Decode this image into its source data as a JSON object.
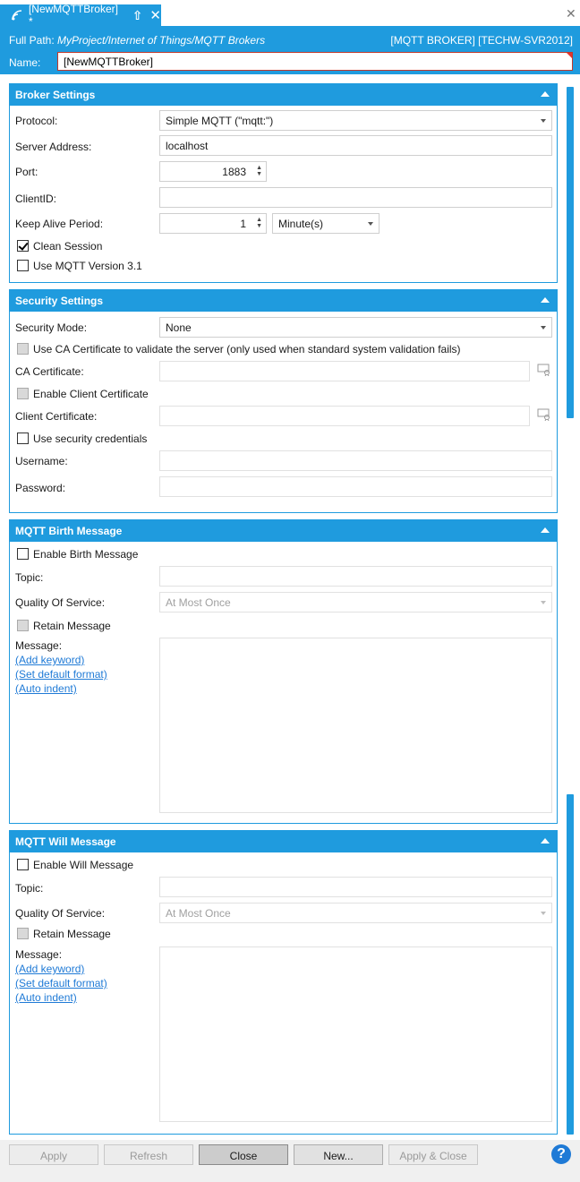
{
  "tab": {
    "title": "[NewMQTTBroker] *"
  },
  "header": {
    "full_path_label": "Full Path:",
    "full_path_value": "MyProject/Internet of Things/MQTT Brokers",
    "badge": "[MQTT BROKER] [TECHW-SVR2012]",
    "name_label": "Name:",
    "name_value": "[NewMQTTBroker]"
  },
  "broker": {
    "title": "Broker Settings",
    "protocol_label": "Protocol:",
    "protocol_value": "Simple MQTT (\"mqtt:\")",
    "server_label": "Server Address:",
    "server_value": "localhost",
    "port_label": "Port:",
    "port_value": "1883",
    "clientid_label": "ClientID:",
    "clientid_value": "",
    "keepalive_label": "Keep Alive Period:",
    "keepalive_value": "1",
    "keepalive_unit": "Minute(s)",
    "clean_session_label": "Clean Session",
    "clean_session_checked": true,
    "mqtt31_label": "Use MQTT Version 3.1",
    "mqtt31_checked": false
  },
  "security": {
    "title": "Security Settings",
    "mode_label": "Security Mode:",
    "mode_value": "None",
    "use_ca_label": "Use CA Certificate to validate the server (only used when standard system validation fails)",
    "ca_cert_label": "CA Certificate:",
    "enable_client_cert_label": "Enable Client Certificate",
    "client_cert_label": "Client Certificate:",
    "use_credentials_label": "Use security credentials",
    "username_label": "Username:",
    "password_label": "Password:"
  },
  "birth": {
    "title": "MQTT Birth Message",
    "enable_label": "Enable Birth Message",
    "topic_label": "Topic:",
    "qos_label": "Quality Of Service:",
    "qos_value": "At Most Once",
    "retain_label": "Retain Message",
    "message_label": "Message:",
    "add_keyword": "(Add keyword)",
    "set_default_format": "(Set default format)",
    "auto_indent": "(Auto indent)"
  },
  "will": {
    "title": "MQTT Will Message",
    "enable_label": "Enable Will Message",
    "topic_label": "Topic:",
    "qos_label": "Quality Of Service:",
    "qos_value": "At Most Once",
    "retain_label": "Retain Message",
    "message_label": "Message:",
    "add_keyword": "(Add keyword)",
    "set_default_format": "(Set default format)",
    "auto_indent": "(Auto indent)"
  },
  "footer": {
    "apply": "Apply",
    "refresh": "Refresh",
    "close": "Close",
    "new": "New...",
    "apply_close": "Apply & Close",
    "help": "?"
  },
  "colors": {
    "accent": "#1f9bde",
    "link": "#1f7ad6"
  },
  "icons": {
    "tab": "broadcast-icon",
    "pin": "pin-up-arrow-icon",
    "close": "close-icon",
    "cert": "certificate-picker-icon",
    "help": "help-icon"
  }
}
